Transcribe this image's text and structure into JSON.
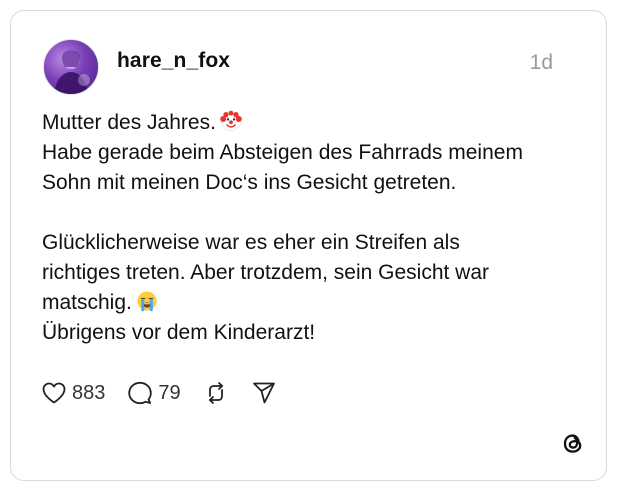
{
  "post": {
    "username": "hare_n_fox",
    "time": "1d",
    "lines": {
      "l1": "Mutter des Jahres.",
      "l2": "Habe gerade beim Absteigen des Fahrrads meinem",
      "l3": "Sohn mit meinen Doc‘s ins Gesicht getreten.",
      "l4": "Glücklicherweise war es eher ein Streifen als",
      "l5": "richtiges treten. Aber trotzdem, sein Gesicht war",
      "l6": "matschig.",
      "l7": "Übrigens vor dem Kinderarzt!"
    },
    "emojis": [
      "clown-face-emoji",
      "loudly-crying-face-emoji"
    ]
  },
  "actions": {
    "likes": "883",
    "comments": "79"
  },
  "icons": [
    "heart-icon",
    "comment-icon",
    "repost-icon",
    "share-icon",
    "threads-logo-icon"
  ],
  "colors": {
    "border": "#d9d9d9",
    "text": "#111111",
    "muted": "#9a9a9a",
    "avatar": "#7a3fb8"
  }
}
